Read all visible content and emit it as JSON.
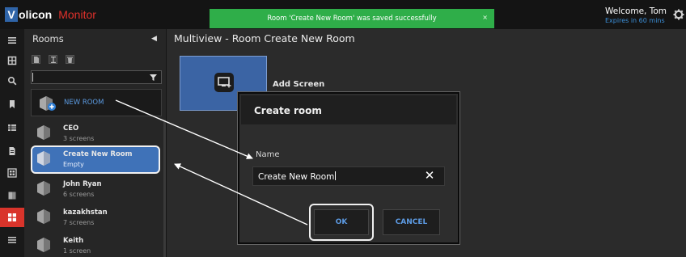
{
  "app": {
    "logo_first": "V",
    "logo_rest": "olicon",
    "logo_product": "Monitor"
  },
  "toast": {
    "message": "Room 'Create New Room' was saved successfully",
    "close": "×",
    "color": "#2fae49"
  },
  "user": {
    "welcome": "Welcome, Tom",
    "expires": "Expires in 60 mins"
  },
  "rail": {
    "icons": [
      "menu-icon",
      "grid-icon",
      "search-icon",
      "bookmark-icon",
      "table-icon",
      "document-icon",
      "gallery-icon",
      "layers-icon",
      "rooms-icon",
      "list-icon"
    ],
    "active": "rooms-icon",
    "active_color": "#d9342b"
  },
  "rooms_panel": {
    "title": "Rooms",
    "collapse": "◀",
    "tools": [
      "file-icon",
      "text-icon",
      "trash-icon"
    ],
    "filter_value": "",
    "new_room_label": "NEW ROOM",
    "rooms": [
      {
        "name": "CEO",
        "screens": "3 screens",
        "selected": false
      },
      {
        "name": "Create New Room",
        "screens": "Empty",
        "selected": true
      },
      {
        "name": "John Ryan",
        "screens": "6 screens",
        "selected": false
      },
      {
        "name": "kazakhstan",
        "screens": "7 screens",
        "selected": false
      },
      {
        "name": "Keith",
        "screens": "1 screen",
        "selected": false
      }
    ]
  },
  "main": {
    "title": "Multiview - Room Create New Room",
    "add_screen": "Add Screen"
  },
  "dialog": {
    "title": "Create room",
    "name_label": "Name",
    "name_value": "Create New Room",
    "clear": "✕",
    "ok": "OK",
    "cancel": "CANCEL"
  }
}
